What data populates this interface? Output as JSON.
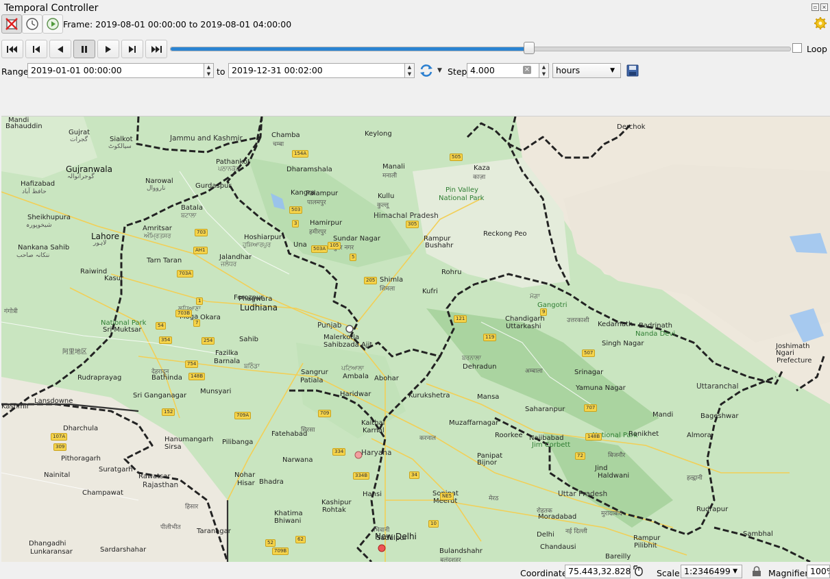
{
  "window": {
    "title": "Temporal Controller",
    "restore_glyph": "▫",
    "close_glyph": "×"
  },
  "toolbar": {
    "frame_text": "Frame: 2019-08-01 00:00:00 to 2019-08-01 04:00:00",
    "icons": [
      "disabled-navigation-icon",
      "fixed-range-icon",
      "animated-play-icon",
      "settings-gear-icon"
    ]
  },
  "playback": {
    "progress": 0.58,
    "loop_label": "Loop",
    "loop_checked": false,
    "accent": "#2a84d2"
  },
  "range": {
    "range_label": "Range",
    "start": "2019-01-01 00:00:00",
    "to_label": "to",
    "end": "2019-12-31 00:02:00",
    "step_label": "Step",
    "step_value": "4.000",
    "unit": "hours"
  },
  "map": {
    "labels": [
      {
        "t": "Mandi",
        "c": ""
      },
      {
        "t": "Bahauddin",
        "c": ""
      },
      {
        "t": "Gujrat",
        "c": ""
      },
      {
        "t": "گجرات",
        "c": "faint"
      },
      {
        "t": "Sialkot",
        "c": ""
      },
      {
        "t": "سیالکوٹ",
        "c": "faint"
      },
      {
        "t": "Jammu and Kashmir",
        "c": "state"
      },
      {
        "t": "Gujranwala",
        "c": "city"
      },
      {
        "t": "گوجرانوالہ",
        "c": "faint"
      },
      {
        "t": "Hafizabad",
        "c": ""
      },
      {
        "t": "حافظ آباد",
        "c": "faint"
      },
      {
        "t": "Narowal",
        "c": ""
      },
      {
        "t": "نارووال",
        "c": "faint"
      },
      {
        "t": "Pathankot",
        "c": ""
      },
      {
        "t": "ਪਠਾਨਕੋਟ",
        "c": "faint"
      },
      {
        "t": "Gurdaspur",
        "c": ""
      },
      {
        "t": "Chamba",
        "c": ""
      },
      {
        "t": "चम्बा",
        "c": "faint"
      },
      {
        "t": "Dharamshala",
        "c": ""
      },
      {
        "t": "Keylong",
        "c": ""
      },
      {
        "t": "Manali",
        "c": ""
      },
      {
        "t": "मनाली",
        "c": "faint"
      },
      {
        "t": "Kaza",
        "c": ""
      },
      {
        "t": "काज़ा",
        "c": "faint"
      },
      {
        "t": "Pin Valley",
        "c": "park"
      },
      {
        "t": "National Park",
        "c": "park"
      },
      {
        "t": "Sheikhupura",
        "c": ""
      },
      {
        "t": "شیخوپورہ",
        "c": "faint"
      },
      {
        "t": "Lahore",
        "c": "city"
      },
      {
        "t": "لاہور",
        "c": "faint"
      },
      {
        "t": "Nankana Sahib",
        "c": ""
      },
      {
        "t": "ننکانہ صاحب",
        "c": "faint"
      },
      {
        "t": "Batala",
        "c": ""
      },
      {
        "t": "ਬਟਾਲਾ",
        "c": "faint"
      },
      {
        "t": "Amritsar",
        "c": ""
      },
      {
        "t": "ਅੰਮ੍ਰਿਤਸਰ",
        "c": "faint"
      },
      {
        "t": "Kangra",
        "c": ""
      },
      {
        "t": "Palampur",
        "c": ""
      },
      {
        "t": "पालमपुर",
        "c": "faint"
      },
      {
        "t": "Kullu",
        "c": ""
      },
      {
        "t": "कुल्लू",
        "c": "faint"
      },
      {
        "t": "Himachal Pradesh",
        "c": "state"
      },
      {
        "t": "Hamirpur",
        "c": ""
      },
      {
        "t": "हमीरपुर",
        "c": "faint"
      },
      {
        "t": "Sundar Nagar",
        "c": ""
      },
      {
        "t": "सुंदर नगर",
        "c": "faint"
      },
      {
        "t": "Rampur",
        "c": ""
      },
      {
        "t": "Bushahr",
        "c": ""
      },
      {
        "t": "Reckong Peo",
        "c": ""
      },
      {
        "t": "Hoshiarpur",
        "c": ""
      },
      {
        "t": "ਹੁਸ਼ਿਆਰਪੁਰ",
        "c": "faint"
      },
      {
        "t": "Una",
        "c": ""
      },
      {
        "t": "Raiwind",
        "c": ""
      },
      {
        "t": "Kasur",
        "c": ""
      },
      {
        "t": "Tarn Taran",
        "c": ""
      },
      {
        "t": "Jalandhar",
        "c": ""
      },
      {
        "t": "ਜਲੰਧਰ",
        "c": "faint"
      },
      {
        "t": "Shimla",
        "c": ""
      },
      {
        "t": "शिमला",
        "c": "faint"
      },
      {
        "t": "Kufri",
        "c": ""
      },
      {
        "t": "Rohru",
        "c": ""
      },
      {
        "t": "Ferozpur",
        "c": ""
      },
      {
        "t": "Phagwara",
        "c": ""
      },
      {
        "t": "Ludhiana",
        "c": "city"
      },
      {
        "t": "ਲੁਧਿਆਣਾ",
        "c": "faint"
      },
      {
        "t": "Moga",
        "c": ""
      },
      {
        "t": "ਮੋਗਾ",
        "c": "faint"
      },
      {
        "t": "Gangotri",
        "c": "park"
      },
      {
        "t": "गंगोत्री",
        "c": "faint"
      },
      {
        "t": "Okara",
        "c": ""
      },
      {
        "t": "Punjab",
        "c": "state"
      },
      {
        "t": "Chandigarh",
        "c": ""
      },
      {
        "t": "Uttarkashi",
        "c": ""
      },
      {
        "t": "उत्तरकाशी",
        "c": "faint"
      },
      {
        "t": "Kedarnath",
        "c": ""
      },
      {
        "t": "Badrinath",
        "c": ""
      },
      {
        "t": "Nanda Devi",
        "c": "park"
      },
      {
        "t": "National Park",
        "c": "park"
      },
      {
        "t": "Sri Muktsar",
        "c": ""
      },
      {
        "t": "Sahib",
        "c": ""
      },
      {
        "t": "Malerkotla",
        "c": ""
      },
      {
        "t": "Sahibzada Ajit",
        "c": ""
      },
      {
        "t": "Singh Nagar",
        "c": ""
      },
      {
        "t": "Joshimath",
        "c": ""
      },
      {
        "t": "Ngari",
        "c": ""
      },
      {
        "t": "Prefecture",
        "c": ""
      },
      {
        "t": "阿里地区",
        "c": "faint"
      },
      {
        "t": "Fazilka",
        "c": ""
      },
      {
        "t": "Barnala",
        "c": ""
      },
      {
        "t": "ਬਰਨਾਲਾ",
        "c": "faint"
      },
      {
        "t": "Dehradun",
        "c": ""
      },
      {
        "t": "देहरादून",
        "c": "faint"
      },
      {
        "t": "Bathinda",
        "c": ""
      },
      {
        "t": "ਬਠਿੰਡਾ",
        "c": "faint"
      },
      {
        "t": "Sangrur",
        "c": ""
      },
      {
        "t": "Patiala",
        "c": ""
      },
      {
        "t": "ਪਟਿਆਲਾ",
        "c": "faint"
      },
      {
        "t": "Ambala",
        "c": ""
      },
      {
        "t": "अम्बाला",
        "c": "faint"
      },
      {
        "t": "Srinagar",
        "c": ""
      },
      {
        "t": "Rudraprayag",
        "c": ""
      },
      {
        "t": "Abohar",
        "c": ""
      },
      {
        "t": "Yamuna Nagar",
        "c": ""
      },
      {
        "t": "Uttaranchal",
        "c": "state"
      },
      {
        "t": "Munsyari",
        "c": ""
      },
      {
        "t": "Mansa",
        "c": ""
      },
      {
        "t": "Haridwar",
        "c": ""
      },
      {
        "t": "Kurukshetra",
        "c": ""
      },
      {
        "t": "Saharanpur",
        "c": ""
      },
      {
        "t": "Lansdowne",
        "c": ""
      },
      {
        "t": "Sri Ganganagar",
        "c": ""
      },
      {
        "t": "Mandi",
        "c": ""
      },
      {
        "t": "Bageshwar",
        "c": ""
      },
      {
        "t": "Dharchula",
        "c": ""
      },
      {
        "t": "Hanumangarh",
        "c": ""
      },
      {
        "t": "Sirsa",
        "c": ""
      },
      {
        "t": "सिरसा",
        "c": "faint"
      },
      {
        "t": "Kaithal",
        "c": ""
      },
      {
        "t": "Karnal",
        "c": ""
      },
      {
        "t": "करनाल",
        "c": "faint"
      },
      {
        "t": "Muzaffarnagar",
        "c": ""
      },
      {
        "t": "Roorkee",
        "c": ""
      },
      {
        "t": "Najibabad",
        "c": ""
      },
      {
        "t": "Jim Corbett",
        "c": "park"
      },
      {
        "t": "National Park",
        "c": "park"
      },
      {
        "t": "Ranikhet",
        "c": ""
      },
      {
        "t": "Almora",
        "c": ""
      },
      {
        "t": "Pithoragarh",
        "c": ""
      },
      {
        "t": "Pilibanga",
        "c": ""
      },
      {
        "t": "Fatehabad",
        "c": ""
      },
      {
        "t": "Narwana",
        "c": ""
      },
      {
        "t": "Haryana",
        "c": "state"
      },
      {
        "t": "Panipat",
        "c": ""
      },
      {
        "t": "Bijnor",
        "c": ""
      },
      {
        "t": "बिजनौर",
        "c": "faint"
      },
      {
        "t": "Nainital",
        "c": ""
      },
      {
        "t": "Suratgarh",
        "c": ""
      },
      {
        "t": "Rawatsar",
        "c": ""
      },
      {
        "t": "Nohar",
        "c": ""
      },
      {
        "t": "Hisar",
        "c": ""
      },
      {
        "t": "हिसार",
        "c": "faint"
      },
      {
        "t": "Jind",
        "c": ""
      },
      {
        "t": "Haldwani",
        "c": ""
      },
      {
        "t": "हल्द्वानी",
        "c": "faint"
      },
      {
        "t": "Champawat",
        "c": ""
      },
      {
        "t": "Rajasthan",
        "c": "state"
      },
      {
        "t": "Bhadra",
        "c": ""
      },
      {
        "t": "Hansi",
        "c": ""
      },
      {
        "t": "Sonipat",
        "c": ""
      },
      {
        "t": "Meerut",
        "c": ""
      },
      {
        "t": "मेरठ",
        "c": "faint"
      },
      {
        "t": "Uttar Pradesh",
        "c": "state"
      },
      {
        "t": "Kashipur",
        "c": ""
      },
      {
        "t": "Rohtak",
        "c": ""
      },
      {
        "t": "रोहतक",
        "c": "faint"
      },
      {
        "t": "Moradabad",
        "c": ""
      },
      {
        "t": "मुरादाबाद",
        "c": "faint"
      },
      {
        "t": "Rudrapur",
        "c": ""
      },
      {
        "t": "Khatima",
        "c": ""
      },
      {
        "t": "Bhiwani",
        "c": ""
      },
      {
        "t": "भिवानी",
        "c": "faint"
      },
      {
        "t": "New Delhi",
        "c": "city"
      },
      {
        "t": "नई दिल्ली",
        "c": "faint"
      },
      {
        "t": "Rampur",
        "c": ""
      },
      {
        "t": "Pilibhit",
        "c": ""
      },
      {
        "t": "पीलीभीत",
        "c": "faint"
      },
      {
        "t": "Taranagar",
        "c": ""
      },
      {
        "t": "Sadulpur",
        "c": ""
      },
      {
        "t": "Delhi",
        "c": ""
      },
      {
        "t": "Sambhal",
        "c": ""
      },
      {
        "t": "Dhangadhi",
        "c": ""
      },
      {
        "t": "Lunkaransar",
        "c": ""
      },
      {
        "t": "Sardarshahar",
        "c": ""
      },
      {
        "t": "Bulandshahr",
        "c": ""
      },
      {
        "t": "बुलंदशहर",
        "c": "faint"
      },
      {
        "t": "Chandausi",
        "c": ""
      },
      {
        "t": "Bareilly",
        "c": ""
      },
      {
        "t": "Derchok",
        "c": ""
      },
      {
        "t": "Kashmir",
        "c": ""
      }
    ],
    "roads": [
      "154A",
      "505",
      "503",
      "3",
      "305",
      "503A",
      "105",
      "5",
      "205",
      "54",
      "703A",
      "703B",
      "703",
      "AH1",
      "1",
      "7",
      "354",
      "254",
      "754",
      "148B",
      "152",
      "709A",
      "709",
      "334",
      "334B",
      "NE5",
      "10",
      "62",
      "52",
      "709B",
      "107A",
      "309",
      "34",
      "507",
      "707",
      "72",
      "9",
      "119",
      "121",
      "148B"
    ]
  },
  "status": {
    "coordinate_label": "Coordinate",
    "coordinate_value": "75.443,32.828",
    "scale_label": "Scale",
    "scale_value": "1:2346499",
    "magnifier_label": "Magnifier",
    "magnifier_value": "100%"
  }
}
